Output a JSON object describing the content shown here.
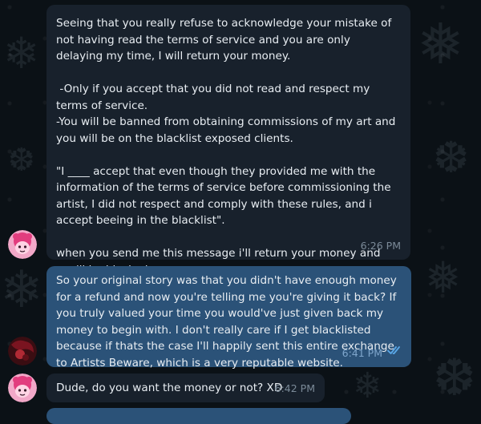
{
  "messages": [
    {
      "text": "Seeing that you really refuse to acknowledge your mistake of not having read the terms of service and you are only delaying my time, I will return your money.\n\n -Only if you accept that you did not read and respect my terms of service.\n-You will be banned from obtaining commissions of my art and you will be on the blacklist exposed clients.\n\n\"I ____ accept that even though they provided me with the information of the terms of service before commissioning the artist, I did not respect and comply with these rules, and i accept beeing in the blacklist\".\n\nwhen you send me this message i'll return your money and you'll be blocked.",
      "time": "6:26 PM"
    },
    {
      "text": "So your original story was that you didn't have enough money for a refund and now you're telling me you're giving it back? If you truly valued your time you would've just given back my money to begin with. I don't really care if I get blacklisted because if thats the case I'll happily sent this entire exchange to Artists Beware, which is a very reputable website.",
      "time": "6:41 PM"
    },
    {
      "text": "Dude, do you want the money or not? XD",
      "time": "6:42 PM"
    }
  ],
  "icons": {
    "read_receipt": "double-check-icon",
    "artist_avatar": "pink-character-avatar",
    "user_avatar": "dark-red-avatar"
  },
  "colors": {
    "incoming_bubble": "#18212c",
    "outgoing_bubble": "#2b5278",
    "background": "#0b1116",
    "read_check": "#5aa8e8"
  }
}
